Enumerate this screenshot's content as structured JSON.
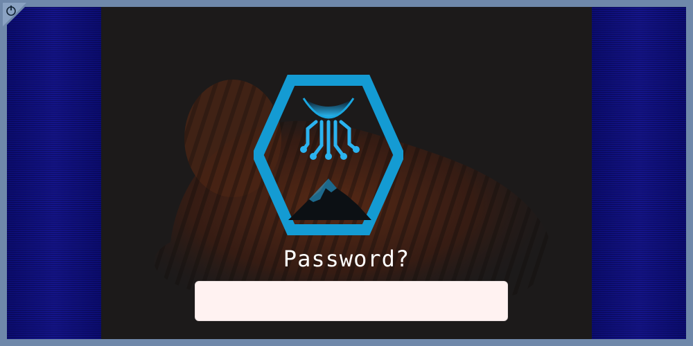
{
  "prompt": {
    "label": "Password?"
  },
  "password": {
    "value": "",
    "placeholder": ""
  },
  "icons": {
    "corner": "power-icon",
    "logo": "hexagon-circuit-mountain-logo"
  },
  "colors": {
    "frame": "#6f88aa",
    "side_panel": "#11137f",
    "background": "#1c1a1a",
    "logo_accent": "#1aa7e0",
    "input_bg": "#fff2f1"
  }
}
